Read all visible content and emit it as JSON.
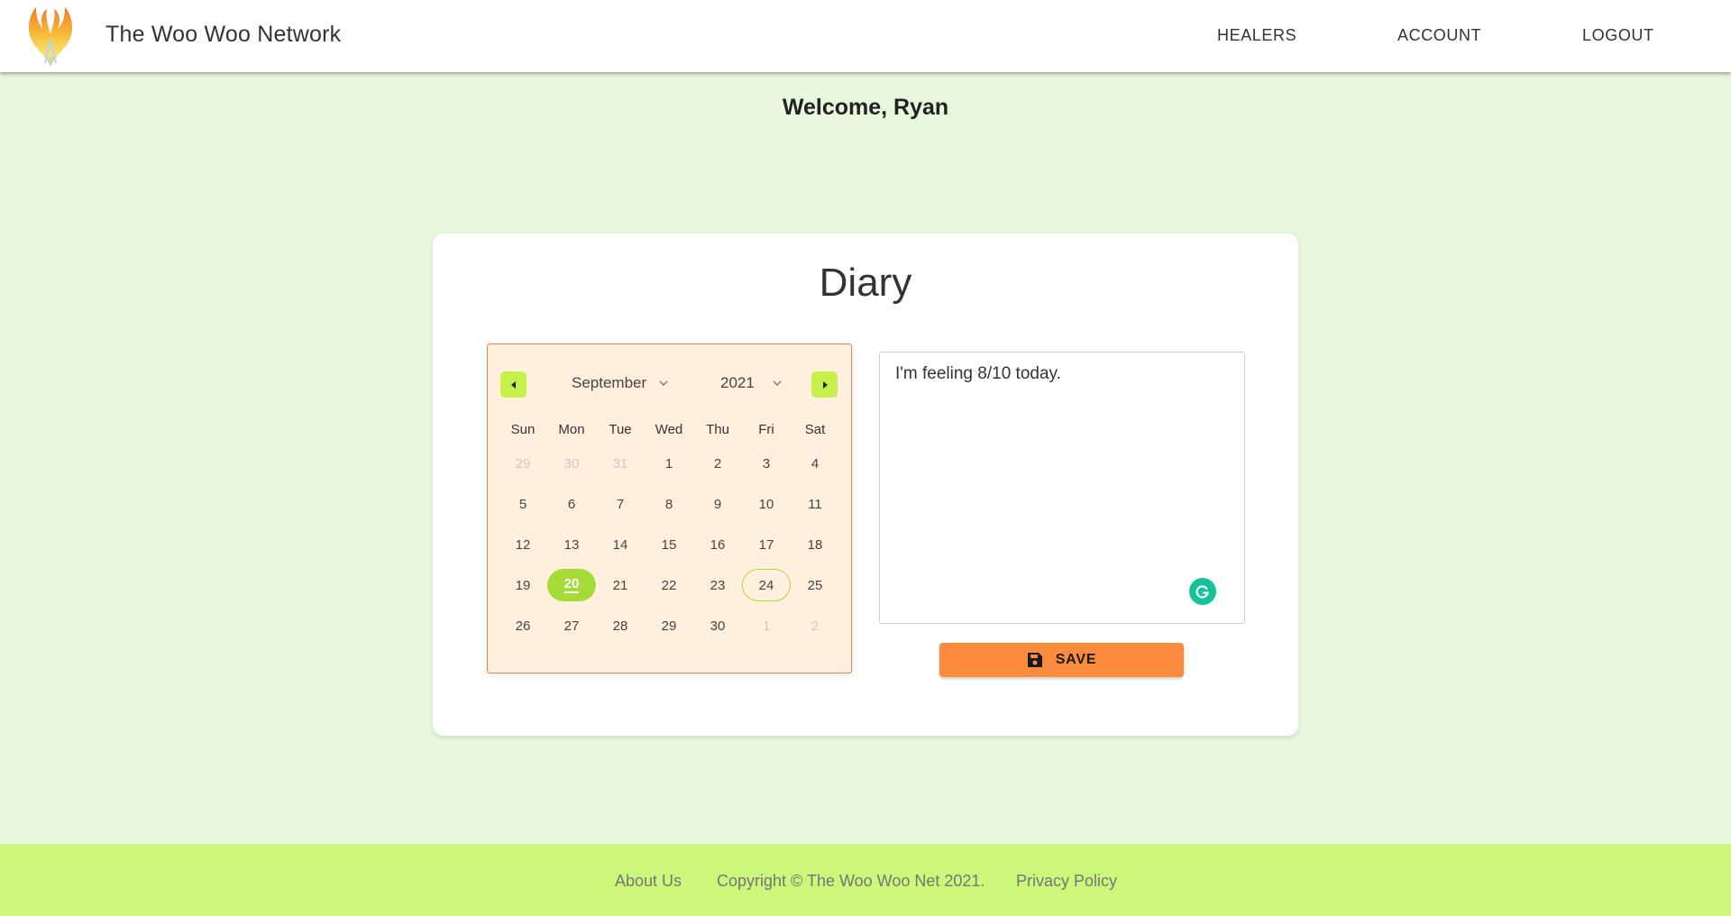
{
  "navbar": {
    "brand": "The Woo Woo Network",
    "links": [
      "HEALERS",
      "ACCOUNT",
      "LOGOUT"
    ],
    "logo_icon": "phoenix-logo"
  },
  "welcome": "Welcome, Ryan",
  "diary": {
    "title": "Diary",
    "calendar": {
      "month": "September",
      "year": "2021",
      "prev_icon": "triangle-left-icon",
      "next_icon": "triangle-right-icon",
      "weekdays": [
        "Sun",
        "Mon",
        "Tue",
        "Wed",
        "Thu",
        "Fri",
        "Sat"
      ],
      "weeks": [
        [
          {
            "d": "29",
            "muted": true
          },
          {
            "d": "30",
            "muted": true
          },
          {
            "d": "31",
            "muted": true
          },
          {
            "d": "1"
          },
          {
            "d": "2"
          },
          {
            "d": "3"
          },
          {
            "d": "4"
          }
        ],
        [
          {
            "d": "5"
          },
          {
            "d": "6"
          },
          {
            "d": "7"
          },
          {
            "d": "8"
          },
          {
            "d": "9"
          },
          {
            "d": "10"
          },
          {
            "d": "11"
          }
        ],
        [
          {
            "d": "12"
          },
          {
            "d": "13"
          },
          {
            "d": "14"
          },
          {
            "d": "15"
          },
          {
            "d": "16"
          },
          {
            "d": "17"
          },
          {
            "d": "18"
          }
        ],
        [
          {
            "d": "19"
          },
          {
            "d": "20",
            "selected": true
          },
          {
            "d": "21"
          },
          {
            "d": "22"
          },
          {
            "d": "23"
          },
          {
            "d": "24",
            "today": true
          },
          {
            "d": "25"
          }
        ],
        [
          {
            "d": "26"
          },
          {
            "d": "27"
          },
          {
            "d": "28"
          },
          {
            "d": "29"
          },
          {
            "d": "30"
          },
          {
            "d": "1",
            "muted": true
          },
          {
            "d": "2",
            "muted": true
          }
        ]
      ],
      "accent_color": "#a6dc38"
    },
    "entry_text": "I'm feeling 8/10 today.",
    "save_label": "SAVE",
    "save_icon": "floppy-disk-icon",
    "save_color": "#fb8c3d"
  },
  "footer": {
    "about": "About Us",
    "copyright": "Copyright © The Woo Woo Net 2021.",
    "privacy": "Privacy Policy"
  }
}
